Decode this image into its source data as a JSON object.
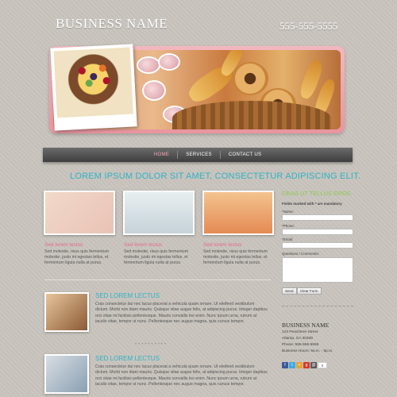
{
  "header": {
    "brand": "BUSINESS NAME",
    "phone": "555-555-5555"
  },
  "nav": {
    "items": [
      {
        "label": "HOME"
      },
      {
        "label": "SERVICES"
      },
      {
        "label": "CONTACT US"
      }
    ]
  },
  "headline": "LOREM IPSUM DOLOR SIT AMET, CONSECTETUR ADIPISCING ELIT.",
  "features": [
    {
      "caption": "Sed lorem lectus",
      "text": "Sed molestie, risus quis fermentum molestie, justo mi egestas tellus, et fermentum ligula nulla at purus."
    },
    {
      "caption": "Sed lorem lectus",
      "text": "Sed molestie, risus quis fermentum molestie, justo mi egestas tellus, et fermentum ligula nulla at purus."
    },
    {
      "caption": "Sed lorem lectus",
      "text": "Sed molestie, risus quis fermentum molestie, justo mi egestas tellus, et fermentum ligula nulla at purus."
    }
  ],
  "articles": [
    {
      "title": "SED LOREM LECTUS",
      "text": "Cras consectetur dui nec lacus placerat a vehicula quam ornare. Ut eleifend vestibulum dictum. Morbi non diam mauris. Quisque vitae augue felis, at adipiscing purus. Integer dapibus orci vitae mi facilisis pellentesque. Mauris convallis leo enim. Nunc ipsum urna, rutrum at iaculis vitae, tempor ut nunc. Pellentesque nec augue magna, quis cursus tempor."
    },
    {
      "title": "SED LOREM LECTUS",
      "text": "Cras consectetur dui nec lacus placerat a vehicula quam ornare. Ut eleifend vestibulum dictum. Morbi non diam mauris. Quisque vitae augue felis, at adipiscing purus. Integer dapibus orci vitae mi facilisis pellentesque. Mauris convallis leo enim. Nunc ipsum urna, rutrum at iaculis vitae, tempor ut nunc. Pellentesque nec augue magna, quis cursus tempor."
    }
  ],
  "form": {
    "heading": "CRAS UT TELLUS EROS.",
    "note": "Fields marked with * are mandatory",
    "name_label": "*Name:",
    "phone_label": "*Phone:",
    "email_label": "*Email:",
    "questions_label": "Questions / Comments:",
    "send": "Send",
    "clear": "Clear Form"
  },
  "business": {
    "name": "BUSINESS NAME",
    "street": "123 Peachtree Street",
    "city": "Atlanta, GA 30308",
    "phone": "Phone: 555-555-5555",
    "hours": "Business Hours: 9a.m. - 5p.m."
  },
  "social": {
    "count": "0"
  },
  "colors": {
    "accent_teal": "#2fb3c6",
    "accent_pink": "#e56b86",
    "accent_green": "#8ec94d"
  }
}
